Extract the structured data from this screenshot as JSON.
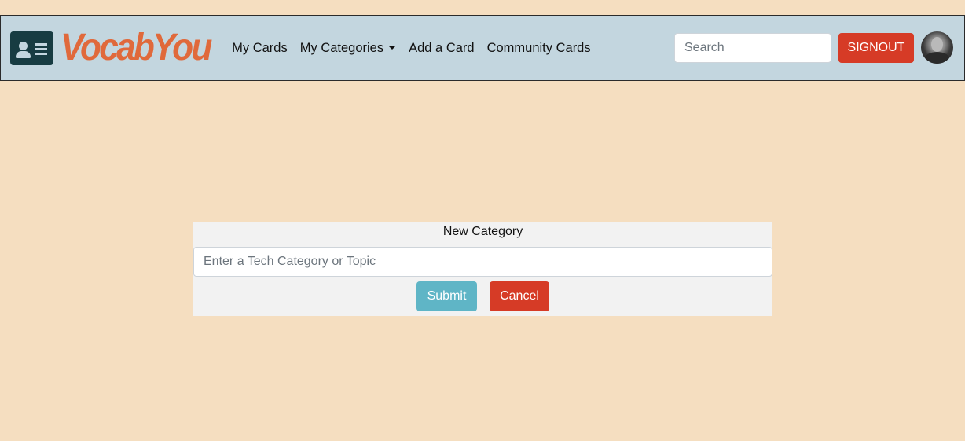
{
  "navbar": {
    "brand_name": "VocabYou",
    "links": [
      {
        "label": "My Cards"
      },
      {
        "label": "My Categories"
      },
      {
        "label": "Add a Card"
      },
      {
        "label": "Community Cards"
      }
    ],
    "search_placeholder": "Search",
    "signout_label": "SIGNOUT"
  },
  "form": {
    "title": "New Category",
    "input_placeholder": "Enter a Tech Category or Topic",
    "submit_label": "Submit",
    "cancel_label": "Cancel"
  },
  "icons": {
    "brand": "id-card-icon",
    "dropdown": "caret-down-icon"
  },
  "colors": {
    "background": "#f5dec0",
    "navbar": "#c3d6df",
    "brand_text": "#e0693b",
    "danger": "#d63b26",
    "info": "#5fb5c6"
  }
}
